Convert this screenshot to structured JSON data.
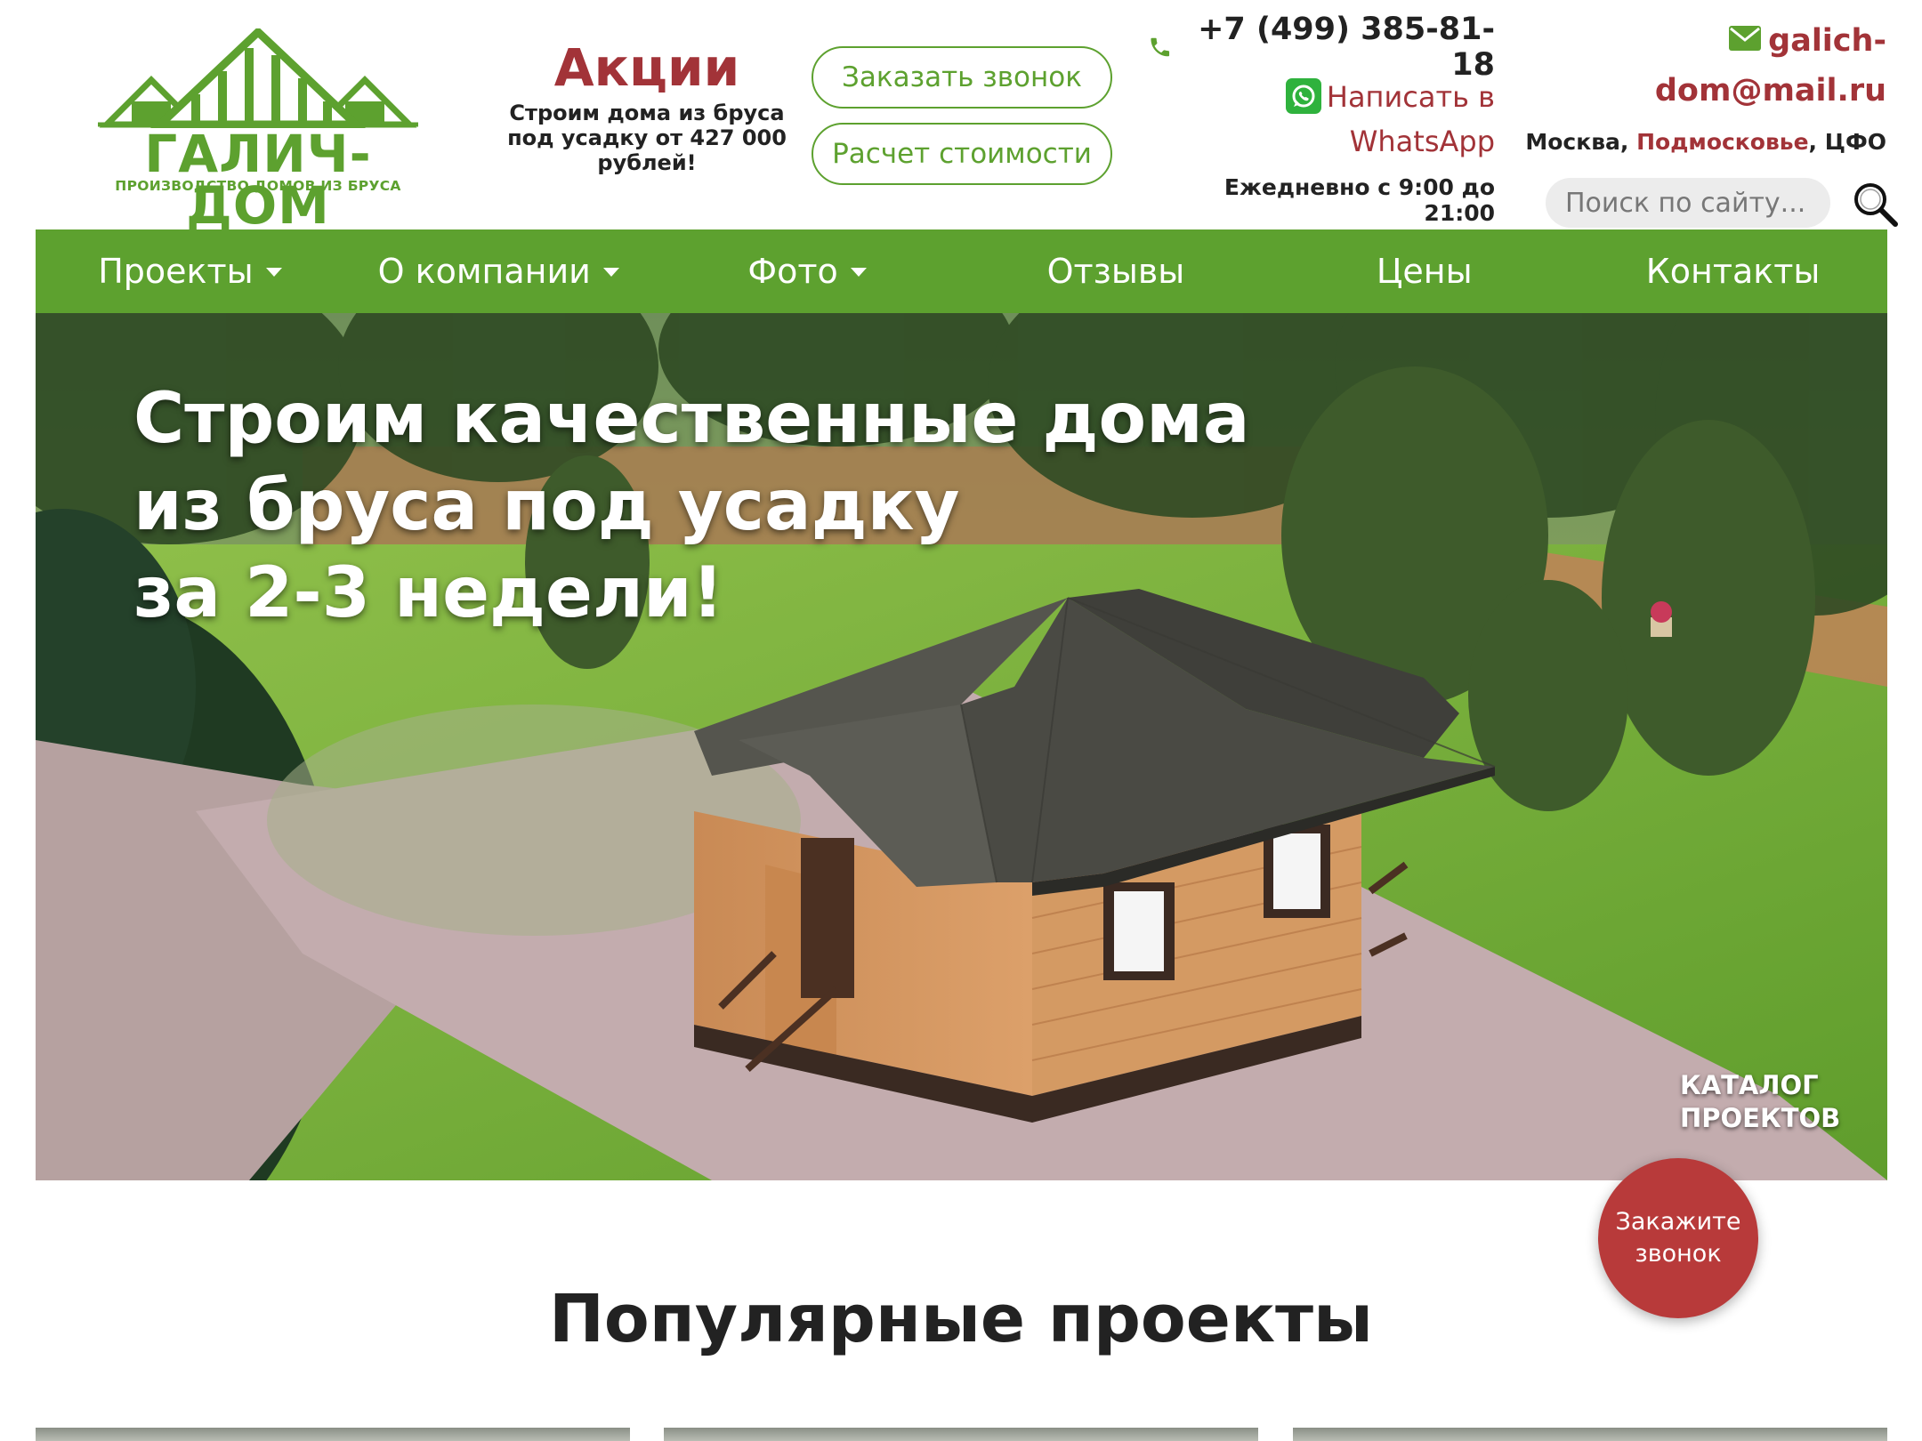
{
  "logo": {
    "name": "ГАЛИЧ-ДОМ",
    "tagline": "ПРОИЗВОДСТВО ДОМОВ ИЗ БРУСА"
  },
  "promo": {
    "title": "Акции",
    "text": "Строим дома из бруса под усадку от 427 000 рублей!"
  },
  "buttons": {
    "call": "Заказать звонок",
    "price": "Расчет стоимости"
  },
  "contacts": {
    "phone": "+7 (499) 385-81-18",
    "whatsapp": "Написать в WhatsApp",
    "hours": "Ежедневно с 9:00 до 21:00",
    "email_line1": "galich-",
    "email_line2": "dom@mail.ru",
    "region_part1": "Москва, ",
    "region_highlight": "Подмосковье",
    "region_part2": ", ЦФО"
  },
  "search": {
    "placeholder": "Поиск по сайту..."
  },
  "nav": {
    "items": [
      {
        "label": "Проекты",
        "dropdown": true
      },
      {
        "label": "О компании",
        "dropdown": true
      },
      {
        "label": "Фото",
        "dropdown": true
      },
      {
        "label": "Отзывы",
        "dropdown": false
      },
      {
        "label": "Цены",
        "dropdown": false
      },
      {
        "label": "Контакты",
        "dropdown": false
      }
    ]
  },
  "hero": {
    "line1": "Строим качественные дома",
    "line2": "из бруса под усадку",
    "line3": "за 2-3 недели!",
    "catalog_line1": "КАТАЛОГ",
    "catalog_line2": "ПРОЕКТОВ"
  },
  "floating_call": "Закажите звонок",
  "section": {
    "popular_title": "Популярные проекты"
  },
  "colors": {
    "brand_green": "#5da12f",
    "accent_red": "#a23338",
    "float_button": "#b83a3a"
  },
  "icons": {
    "phone": "phone-icon",
    "whatsapp": "whatsapp-icon",
    "email": "envelope-icon",
    "search": "magnifier-icon",
    "dropdown": "caret-down-icon"
  }
}
